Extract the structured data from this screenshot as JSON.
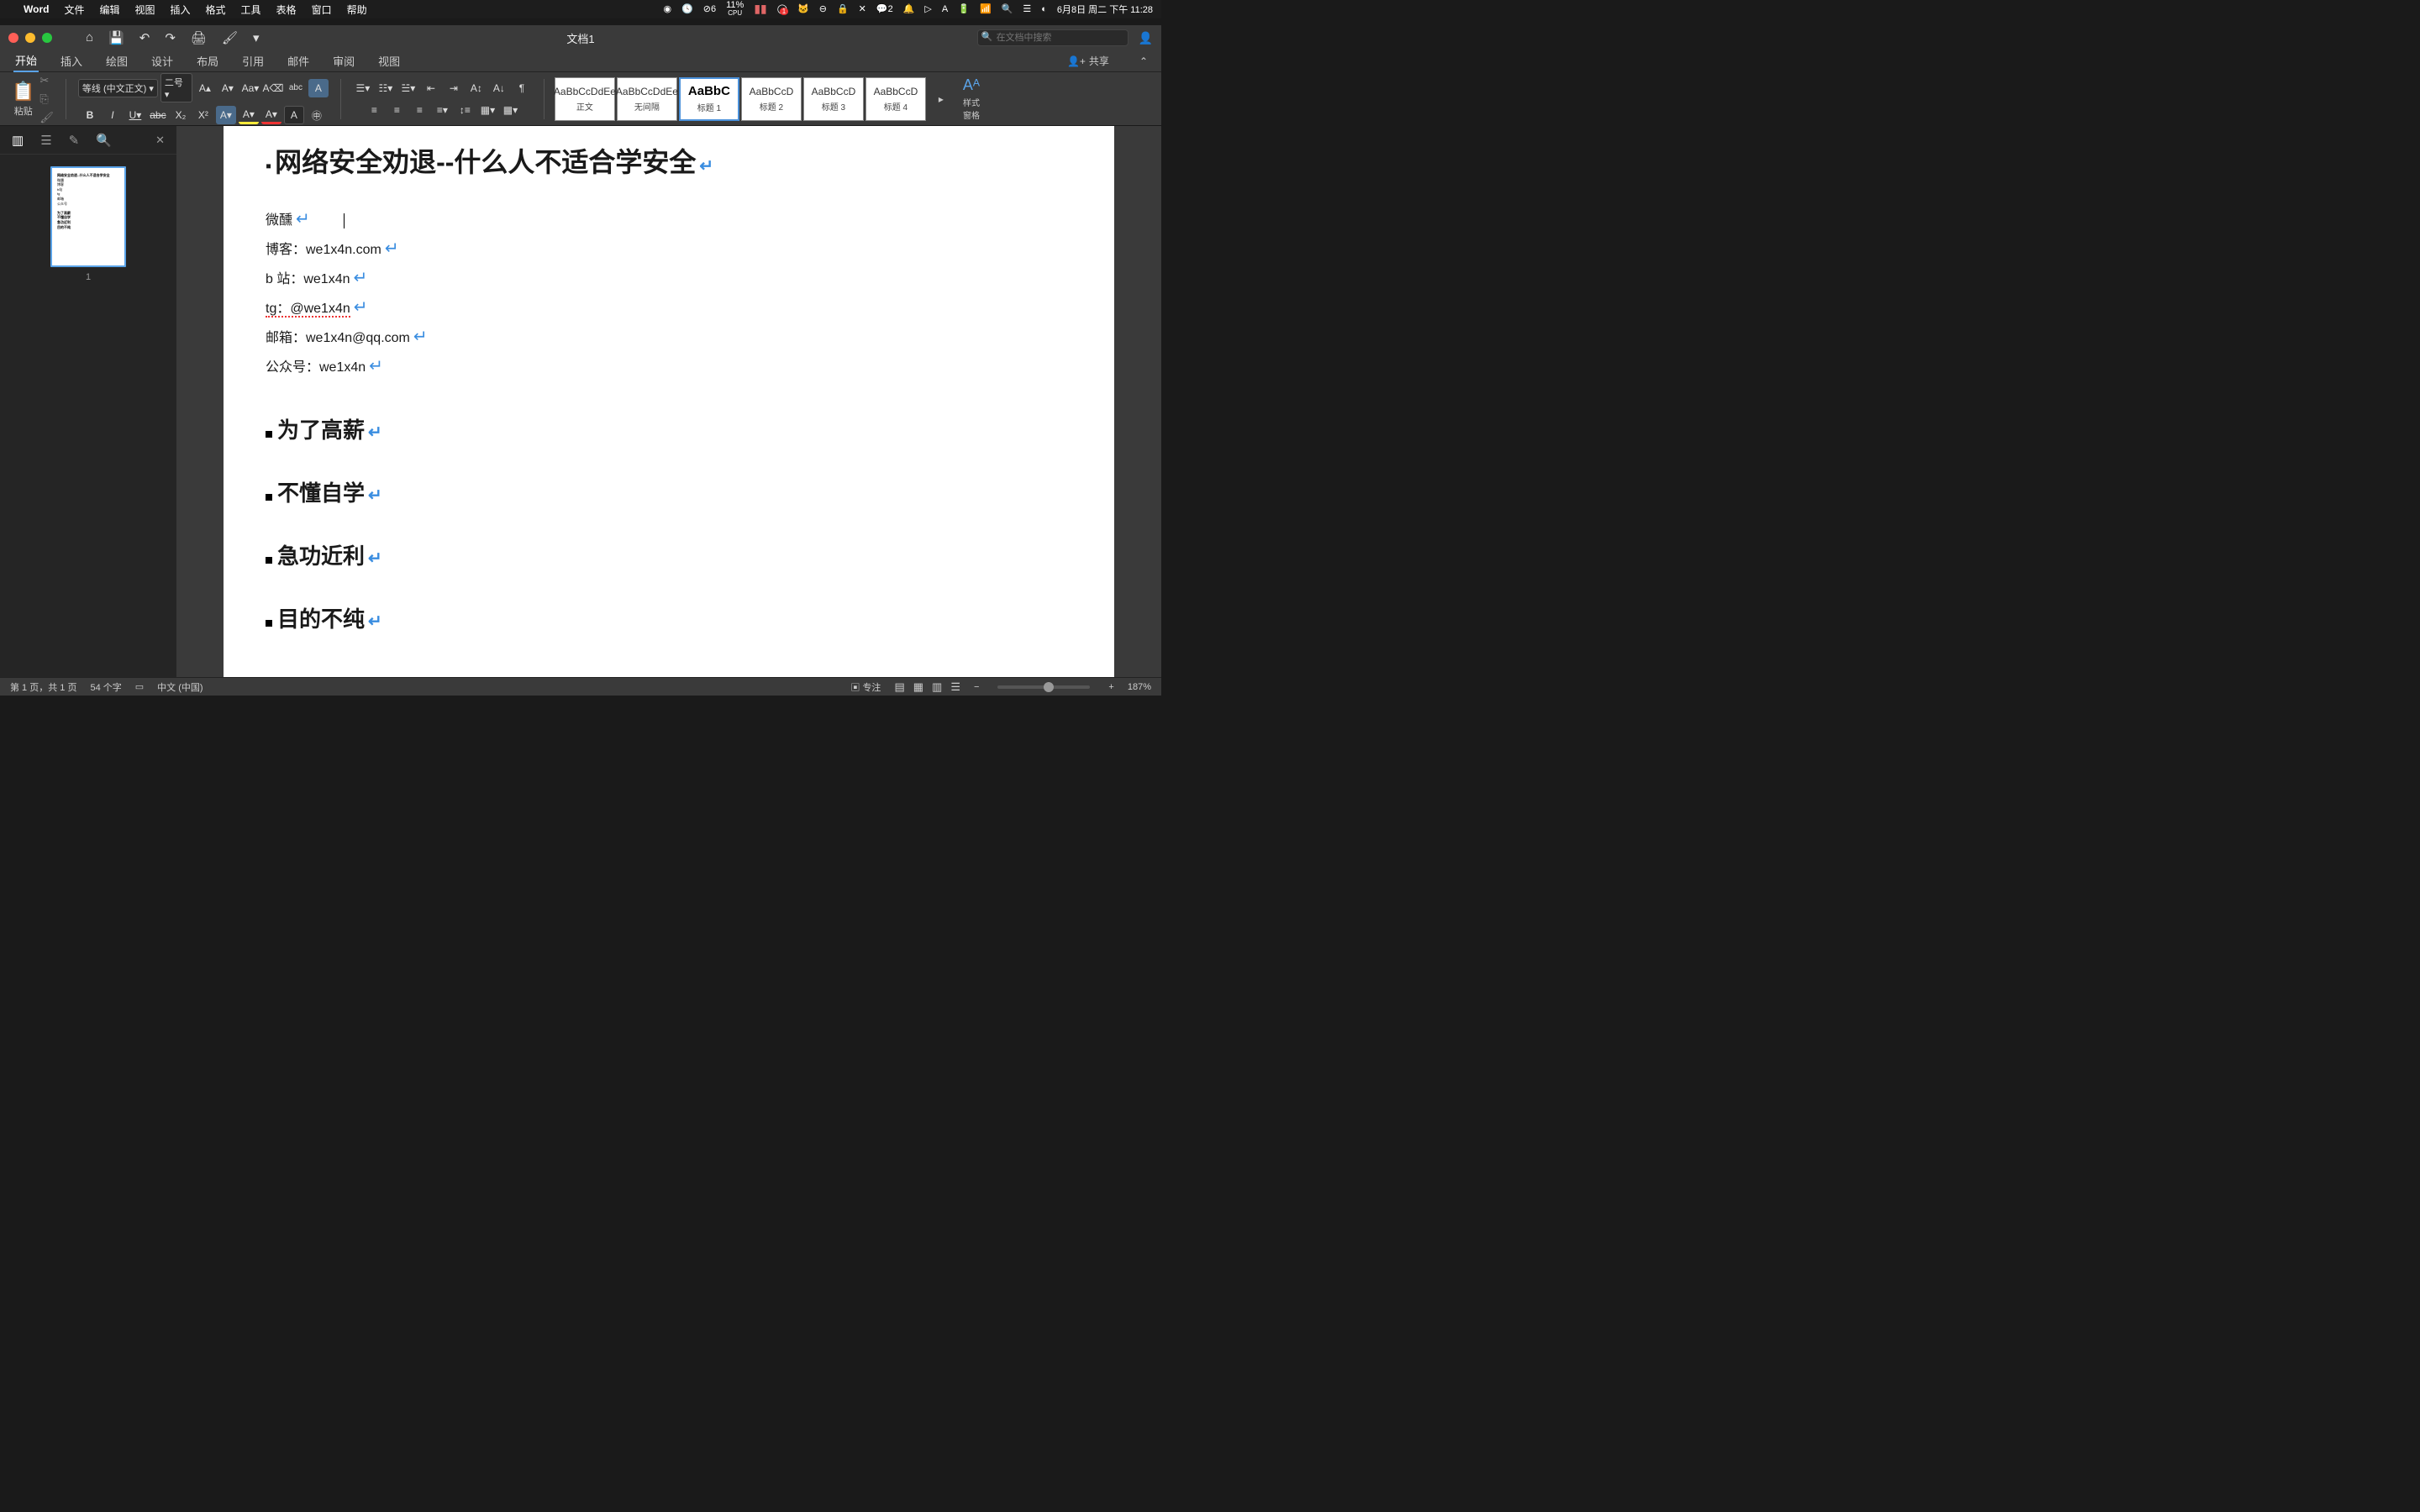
{
  "macos_menubar": {
    "app_name": "Word",
    "menus": [
      "文件",
      "编辑",
      "视图",
      "插入",
      "格式",
      "工具",
      "表格",
      "窗口",
      "帮助"
    ],
    "cpu_label": "11%",
    "cpu_sub": "CPU",
    "badge_o": "6",
    "badge_red": "1",
    "badge_wechat": "2",
    "clock": "6月8日 周二 下午 11:28"
  },
  "titlebar": {
    "doc_title": "文档1",
    "qa_items": [
      "home",
      "save",
      "undo",
      "redo",
      "print",
      "format-painter",
      "dropdown"
    ],
    "search_placeholder": "在文档中搜索"
  },
  "ribbon_tabs": {
    "tabs": [
      "开始",
      "插入",
      "绘图",
      "设计",
      "布局",
      "引用",
      "邮件",
      "审阅",
      "视图"
    ],
    "active": "开始",
    "share_label": "共享"
  },
  "ribbon": {
    "paste_label": "粘贴",
    "font_name": "等线 (中文正文)",
    "font_size": "二号",
    "style_pane_label": "样式\n窗格"
  },
  "styles": [
    {
      "preview": "AaBbCcDdEe",
      "label": "正文",
      "big": false
    },
    {
      "preview": "AaBbCcDdEe",
      "label": "无间隔",
      "big": false
    },
    {
      "preview": "AaBbC",
      "label": "标题 1",
      "big": true,
      "active": true
    },
    {
      "preview": "AaBbCcD",
      "label": "标题 2",
      "big": false
    },
    {
      "preview": "AaBbCcD",
      "label": "标题 3",
      "big": false
    },
    {
      "preview": "AaBbCcD",
      "label": "标题 4",
      "big": false
    }
  ],
  "nav_pane": {
    "thumb_number": "1"
  },
  "document": {
    "title": "网络安全劝退--什么人不适合学安全",
    "author_lines": [
      "微醺",
      "博客：we1x4n.com",
      "b 站：we1x4n",
      "tg：@we1x4n",
      "邮箱：we1x4n@qq.com",
      "公众号：we1x4n"
    ],
    "headings": [
      "为了高薪",
      "不懂自学",
      "急功近利",
      "目的不纯"
    ]
  },
  "statusbar": {
    "page_info": "第 1 页，共 1 页",
    "word_count": "54 个字",
    "language": "中文 (中国)",
    "focus_label": "专注",
    "zoom": "187%"
  }
}
